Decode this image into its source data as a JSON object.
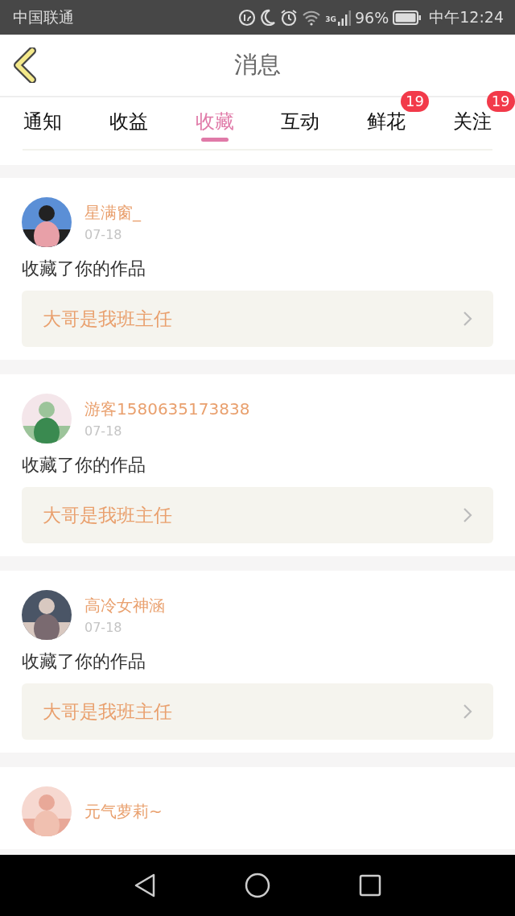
{
  "status_bar": {
    "carrier": "中国联通",
    "network": "3G",
    "battery": "96%",
    "time": "中午12:24"
  },
  "header": {
    "title": "消息"
  },
  "tabs": [
    {
      "label": "通知",
      "selected": false
    },
    {
      "label": "收益",
      "selected": false
    },
    {
      "label": "收藏",
      "selected": true
    },
    {
      "label": "互动",
      "selected": false
    },
    {
      "label": "鲜花",
      "selected": false,
      "badge": "19"
    },
    {
      "label": "关注",
      "selected": false,
      "badge": "19"
    }
  ],
  "messages": [
    {
      "user": "星满窗_",
      "date": "07-18",
      "text": "收藏了你的作品",
      "work": "大哥是我班主任"
    },
    {
      "user": "游客1580635173838",
      "date": "07-18",
      "text": "收藏了你的作品",
      "work": "大哥是我班主任"
    },
    {
      "user": "高冷女神涵",
      "date": "07-18",
      "text": "收藏了你的作品",
      "work": "大哥是我班主任"
    },
    {
      "user": "元气萝莉~"
    }
  ]
}
